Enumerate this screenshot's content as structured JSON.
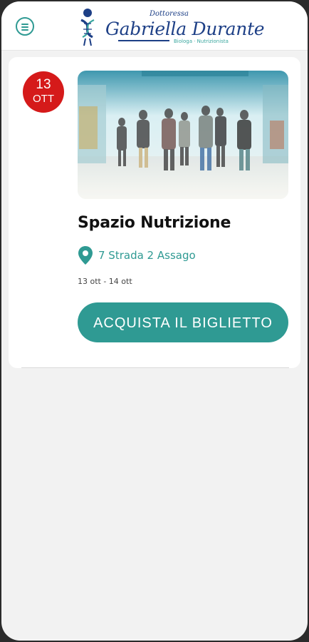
{
  "header": {
    "menu_icon": "hamburger-menu-icon",
    "logo": {
      "small_text": "Dottoressa",
      "name": "Gabriella Durante",
      "subtitle": "Biologa · Nutrizionista",
      "icon": "dna-figure-icon",
      "color": "#1d3f86",
      "accent": "#3aa79f"
    }
  },
  "event": {
    "badge": {
      "day": "13",
      "month": "OTT",
      "color": "#d51a1a"
    },
    "title": "Spazio Nutrizione",
    "location_icon": "map-pin-icon",
    "location": "7 Strada 2 Assago",
    "dates": "13 ott - 14 ott",
    "cta_label": "ACQUISTA IL BIGLIETTO",
    "accent": "#2f9a93"
  }
}
